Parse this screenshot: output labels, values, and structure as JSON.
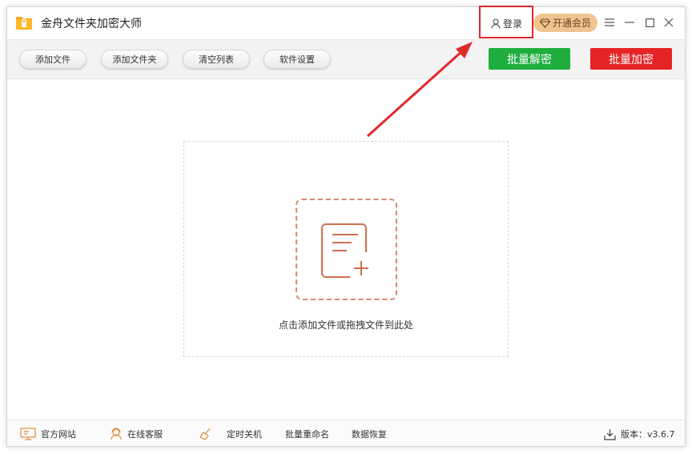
{
  "window": {
    "title": "金舟文件夹加密大师"
  },
  "titlebar": {
    "login_label": "登录",
    "vip_label": "开通会员"
  },
  "toolbar": {
    "add_file_label": "添加文件",
    "add_folder_label": "添加文件夹",
    "clear_list_label": "清空列表",
    "settings_label": "软件设置",
    "batch_decrypt_label": "批量解密",
    "batch_encrypt_label": "批量加密"
  },
  "main": {
    "drop_hint": "点击添加文件或拖拽文件到此处"
  },
  "statusbar": {
    "website_label": "官方网站",
    "service_label": "在线客服",
    "shutdown_label": "定时关机",
    "rename_label": "批量重命名",
    "recovery_label": "数据恢复",
    "version_label": "版本：v3.6.7"
  },
  "colors": {
    "decrypt": "#1fae3e",
    "encrypt": "#e52426",
    "vip": "#f1c48f",
    "accent": "#dd8a6a",
    "annotation": "#e12a2a"
  },
  "icons": [
    "folder-lock-icon",
    "user-icon",
    "diamond-icon",
    "menu-icon",
    "minimize-icon",
    "maximize-icon",
    "close-icon",
    "file-add-icon",
    "monitor-icon",
    "headset-icon",
    "broom-icon",
    "download-icon"
  ]
}
